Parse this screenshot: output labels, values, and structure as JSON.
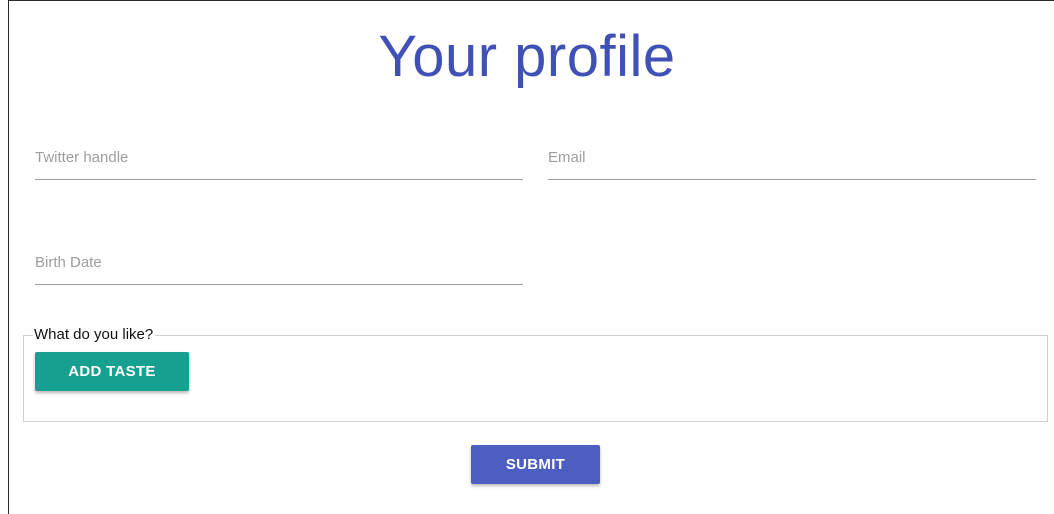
{
  "page": {
    "title": "Your profile"
  },
  "form": {
    "twitter_handle": {
      "placeholder": "Twitter handle",
      "value": ""
    },
    "email": {
      "placeholder": "Email",
      "value": ""
    },
    "birth_date": {
      "placeholder": "Birth Date",
      "value": ""
    },
    "tastes": {
      "legend": "What do you like?",
      "add_button_label": "ADD TASTE"
    },
    "submit_label": "SUBMIT"
  },
  "colors": {
    "title": "#3f51b5",
    "add_taste_button": "#16a08f",
    "submit_button": "#4d5ec1"
  }
}
